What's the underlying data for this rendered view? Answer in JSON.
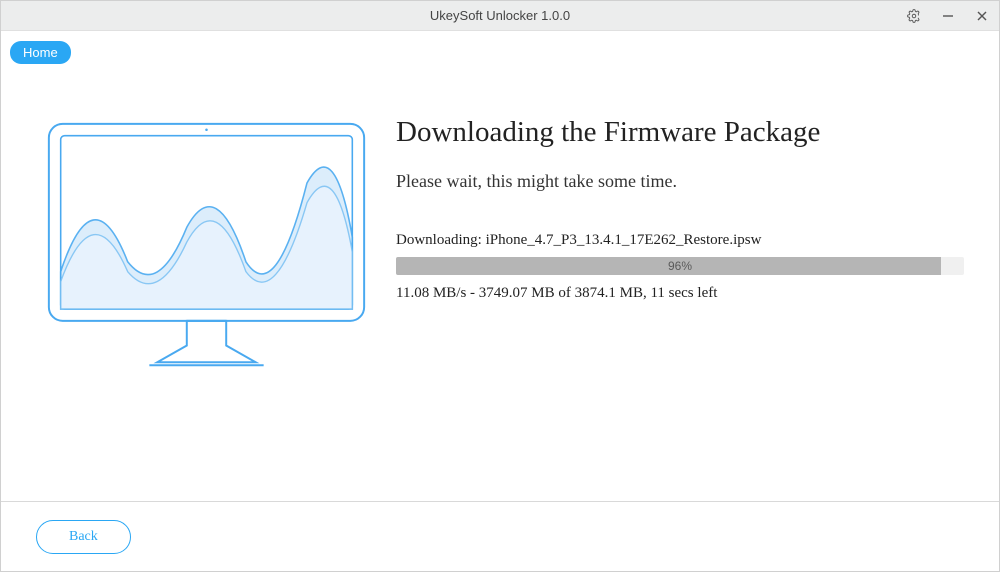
{
  "titlebar": {
    "title": "UkeySoft Unlocker 1.0.0"
  },
  "nav": {
    "home_label": "Home"
  },
  "main": {
    "headline": "Downloading the Firmware Package",
    "subline": "Please wait, this might take some time.",
    "download_label": "Downloading: iPhone_4.7_P3_13.4.1_17E262_Restore.ipsw",
    "progress_percent": 96,
    "progress_text": "96%",
    "speed_text": "11.08 MB/s - 3749.07 MB of 3874.1 MB, 11 secs left"
  },
  "footer": {
    "back_label": "Back"
  },
  "colors": {
    "accent": "#2aa7f4"
  }
}
